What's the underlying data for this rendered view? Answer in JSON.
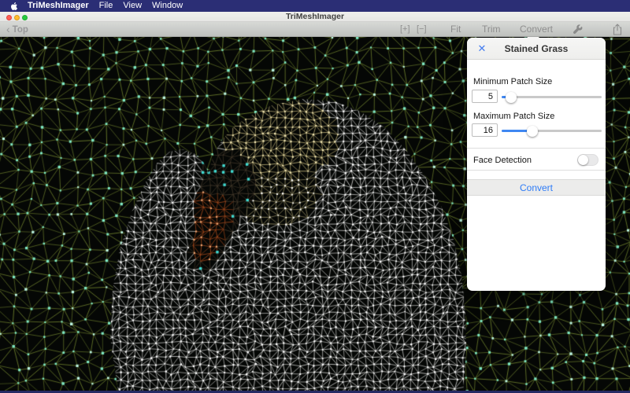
{
  "menu_bar": {
    "app_name": "TriMeshImager",
    "items": [
      "File",
      "View",
      "Window"
    ]
  },
  "window": {
    "title": "TriMeshImager"
  },
  "toolbar": {
    "back_chevron": "‹",
    "back_label": "Top",
    "zoom_in_label": "[+]",
    "zoom_out_label": "[−]",
    "fit_label": "Fit",
    "trim_label": "Trim",
    "convert_label": "Convert"
  },
  "popover": {
    "title": "Stained Grass",
    "close_glyph": "✕",
    "accent": "#3f87f2",
    "min_patch": {
      "label": "Minimum Patch Size",
      "value": "5",
      "fraction": 0.095
    },
    "max_patch": {
      "label": "Maximum Patch Size",
      "value": "16",
      "fraction": 0.31
    },
    "face_detection": {
      "label": "Face Detection",
      "state": "off"
    },
    "convert_label": "Convert"
  },
  "mesh": {
    "bg": "#050705",
    "bg_edge": "#66772a",
    "bg_dot": "#7fe9c6",
    "bg_dot_bright": "#bdf6e6",
    "swan_edge": "#e3e3e1",
    "swan_dot": "#ffffff",
    "yellow_edge": "#d3c383",
    "yellow_dot": "#f3e8b6",
    "warm_edge": "#aaa070",
    "head_edge": "#4c4030",
    "head_dot": "#3fdcd4",
    "beak_edge": "#b34f1e",
    "beak_dot": "#eca572"
  }
}
